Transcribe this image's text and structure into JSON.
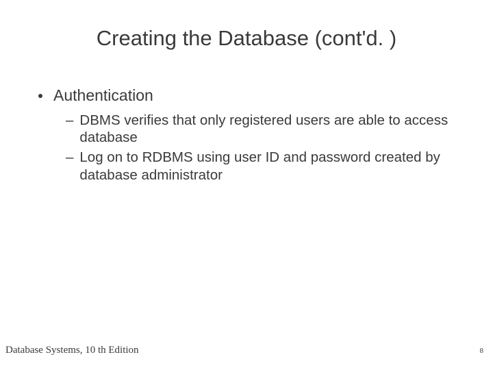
{
  "title": "Creating the Database (cont'd. )",
  "bullets": {
    "l1": "Authentication",
    "l2a": "DBMS verifies that only registered users are able to access database",
    "l2b": "Log on to RDBMS using user ID and password created by database administrator"
  },
  "footer": {
    "left": "Database Systems, 10 th Edition",
    "page": "8"
  }
}
